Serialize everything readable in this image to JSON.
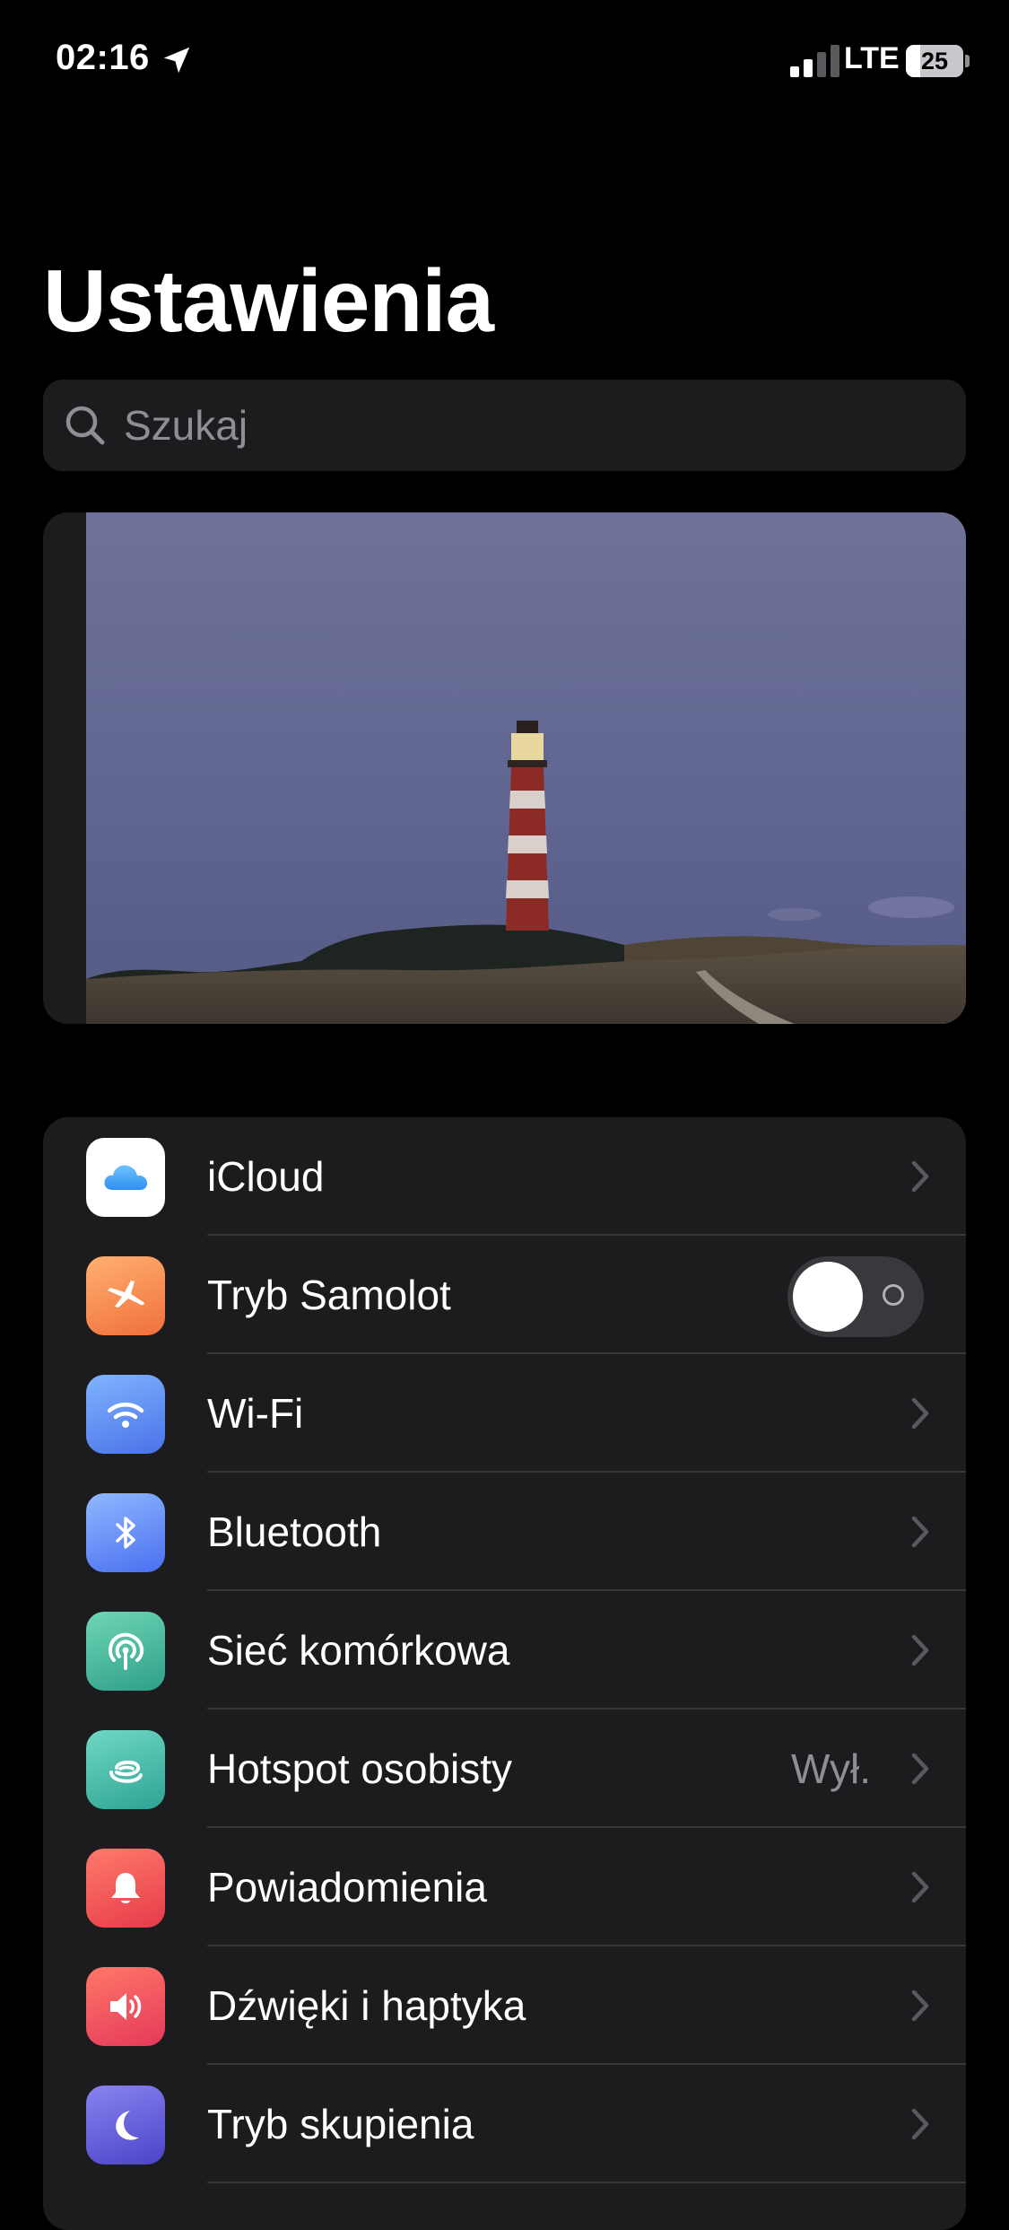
{
  "status_bar": {
    "time": "02:16",
    "network": "LTE",
    "battery_level": "25",
    "battery_fraction": 0.25,
    "signal_bars_active": 2,
    "signal_bars_total": 4
  },
  "header": {
    "title": "Ustawienia"
  },
  "search": {
    "placeholder": "Szukaj",
    "value": ""
  },
  "colors": {
    "background": "#000000",
    "group_background": "#1c1c1e",
    "secondary_text": "#8e8e93",
    "separator": "#38383a",
    "toggle_off": "#39393d"
  },
  "settings": {
    "items": [
      {
        "label": "iCloud",
        "icon": "icloud-icon",
        "accessory": "chevron"
      },
      {
        "label": "Tryb Samolot",
        "icon": "airplane-icon",
        "accessory": "toggle",
        "toggle_on": false
      },
      {
        "label": "Wi-Fi",
        "icon": "wifi-icon",
        "accessory": "chevron"
      },
      {
        "label": "Bluetooth",
        "icon": "bluetooth-icon",
        "accessory": "chevron"
      },
      {
        "label": "Sieć komórkowa",
        "icon": "cellular-icon",
        "accessory": "chevron"
      },
      {
        "label": "Hotspot osobisty",
        "icon": "hotspot-icon",
        "accessory": "chevron",
        "value": "Wył."
      },
      {
        "label": "Powiadomienia",
        "icon": "bell-icon",
        "accessory": "chevron"
      },
      {
        "label": "Dźwięki i haptyka",
        "icon": "speaker-icon",
        "accessory": "chevron"
      },
      {
        "label": "Tryb skupienia",
        "icon": "moon-icon",
        "accessory": "chevron"
      }
    ]
  }
}
